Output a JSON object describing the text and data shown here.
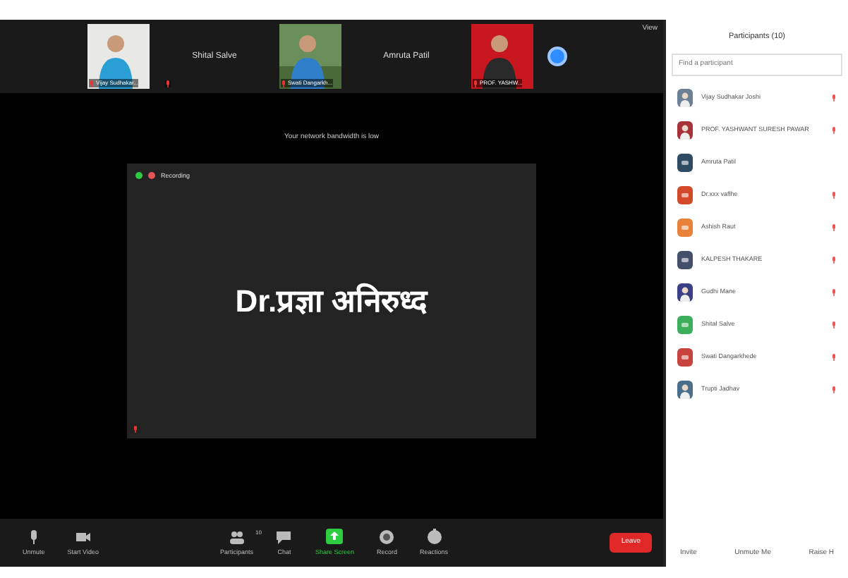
{
  "top_strip": {
    "tiles": [
      {
        "kind": "video",
        "label": "Vijay Sudhakar...",
        "muted": true
      },
      {
        "kind": "name",
        "label": "Shital Salve",
        "muted": true
      },
      {
        "kind": "video",
        "label": "Swati Dangarkh...",
        "muted": true
      },
      {
        "kind": "name",
        "label": "Amruta Patil",
        "muted": false
      },
      {
        "kind": "video",
        "label": "PROF. YASHW...",
        "muted": true
      }
    ],
    "view_button": "View"
  },
  "notice": "Your network bandwidth is low",
  "speaker": {
    "name": "Dr.प्रज्ञा अनिरुध्द",
    "recording": "Recording",
    "muted": true
  },
  "toolbar": [
    {
      "kind": "mic",
      "label": "Unmute"
    },
    {
      "kind": "video",
      "label": "Start Video"
    },
    {
      "kind": "participants",
      "label": "Participants",
      "count": "10"
    },
    {
      "kind": "chat",
      "label": "Chat"
    },
    {
      "kind": "share",
      "label": "Share Screen"
    },
    {
      "kind": "record",
      "label": "Record"
    },
    {
      "kind": "reactions",
      "label": "Reactions"
    }
  ],
  "leave_button": "Leave",
  "panel": {
    "title": "Participants (10)",
    "search": {
      "placeholder": "Find a participant"
    },
    "participants": [
      {
        "name": "Vijay Sudhakar Joshi",
        "color": "#6b7f95",
        "muted": true
      },
      {
        "name": "PROF. YASHWANT SURESH PAWAR",
        "color": "#a8323a",
        "muted": true
      },
      {
        "name": "Amruta Patil",
        "kind": "initials",
        "color": "#2f4a63",
        "muted": false
      },
      {
        "name": "Dr.xxx vaflhe",
        "kind": "initials",
        "color": "#d24a2a",
        "muted": true
      },
      {
        "name": "Ashish Raut",
        "kind": "initials",
        "color": "#e8823a",
        "muted": true
      },
      {
        "name": "KALPESH THAKARE",
        "kind": "initials",
        "color": "#44506a",
        "muted": true
      },
      {
        "name": "Gudhi Mane",
        "color": "#3b3f86",
        "muted": true
      },
      {
        "name": "Shital Salve",
        "kind": "initials",
        "color": "#3cae5c",
        "muted": true
      },
      {
        "name": "Swati Dangarkhede",
        "kind": "initials",
        "color": "#c8423e",
        "muted": true
      },
      {
        "name": "Trupti Jadhav",
        "color": "#4a6f8a",
        "muted": true
      }
    ],
    "footer_buttons": [
      "Invite",
      "Unmute Me",
      "Raise H"
    ]
  }
}
